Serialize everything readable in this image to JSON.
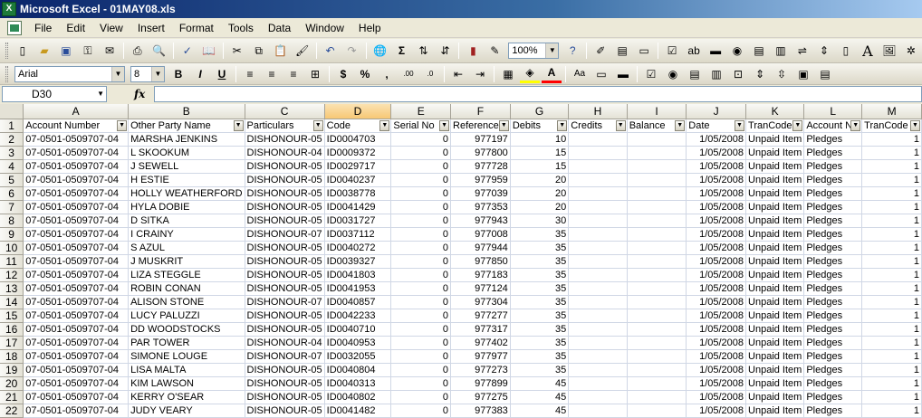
{
  "window": {
    "title": "Microsoft Excel - 01MAY08.xls",
    "app_icon": "excel-icon"
  },
  "menu": [
    "File",
    "Edit",
    "View",
    "Insert",
    "Format",
    "Tools",
    "Data",
    "Window",
    "Help"
  ],
  "toolbar": {
    "zoom": "100%",
    "font": "Arial",
    "font_size": "8",
    "autosum": "Σ"
  },
  "formula_bar": {
    "name_box": "D30",
    "fx": "fx",
    "content": ""
  },
  "grid": {
    "column_letters": [
      "A",
      "B",
      "C",
      "D",
      "E",
      "F",
      "G",
      "H",
      "I",
      "J",
      "K",
      "L",
      "M"
    ],
    "selected_column": "D",
    "header_row": [
      "Account Number",
      "Other Party Name",
      "Particulars",
      "Code",
      "Serial No",
      "Reference",
      "Debits",
      "Credits",
      "Balance",
      "Date",
      "TranCode",
      "Account N",
      "TranCode"
    ],
    "rows": [
      [
        "2",
        "07-0501-0509707-04",
        "MARSHA JENKINS",
        "DISHONOUR-05",
        "ID0004703",
        "0",
        "977197",
        "10",
        "",
        "",
        "1/05/2008",
        "Unpaid Item",
        "Pledges",
        "1"
      ],
      [
        "3",
        "07-0501-0509707-04",
        "L SKOOKUM",
        "DISHONOUR-04",
        "ID0009372",
        "0",
        "977800",
        "15",
        "",
        "",
        "1/05/2008",
        "Unpaid Item",
        "Pledges",
        "1"
      ],
      [
        "4",
        "07-0501-0509707-04",
        "J SEWELL",
        "DISHONOUR-05",
        "ID0029717",
        "0",
        "977728",
        "15",
        "",
        "",
        "1/05/2008",
        "Unpaid Item",
        "Pledges",
        "1"
      ],
      [
        "5",
        "07-0501-0509707-04",
        "H ESTIE",
        "DISHONOUR-05",
        "ID0040237",
        "0",
        "977959",
        "20",
        "",
        "",
        "1/05/2008",
        "Unpaid Item",
        "Pledges",
        "1"
      ],
      [
        "6",
        "07-0501-0509707-04",
        "HOLLY WEATHERFORD",
        "DISHONOUR-05",
        "ID0038778",
        "0",
        "977039",
        "20",
        "",
        "",
        "1/05/2008",
        "Unpaid Item",
        "Pledges",
        "1"
      ],
      [
        "7",
        "07-0501-0509707-04",
        "HYLA DOBIE",
        "DISHONOUR-05",
        "ID0041429",
        "0",
        "977353",
        "20",
        "",
        "",
        "1/05/2008",
        "Unpaid Item",
        "Pledges",
        "1"
      ],
      [
        "8",
        "07-0501-0509707-04",
        "D SITKA",
        "DISHONOUR-05",
        "ID0031727",
        "0",
        "977943",
        "30",
        "",
        "",
        "1/05/2008",
        "Unpaid Item",
        "Pledges",
        "1"
      ],
      [
        "9",
        "07-0501-0509707-04",
        "I CRAINY",
        "DISHONOUR-07",
        "ID0037112",
        "0",
        "977008",
        "35",
        "",
        "",
        "1/05/2008",
        "Unpaid Item",
        "Pledges",
        "1"
      ],
      [
        "10",
        "07-0501-0509707-04",
        "S AZUL",
        "DISHONOUR-05",
        "ID0040272",
        "0",
        "977944",
        "35",
        "",
        "",
        "1/05/2008",
        "Unpaid Item",
        "Pledges",
        "1"
      ],
      [
        "11",
        "07-0501-0509707-04",
        "J MUSKRIT",
        "DISHONOUR-05",
        "ID0039327",
        "0",
        "977850",
        "35",
        "",
        "",
        "1/05/2008",
        "Unpaid Item",
        "Pledges",
        "1"
      ],
      [
        "12",
        "07-0501-0509707-04",
        "LIZA STEGGLE",
        "DISHONOUR-05",
        "ID0041803",
        "0",
        "977183",
        "35",
        "",
        "",
        "1/05/2008",
        "Unpaid Item",
        "Pledges",
        "1"
      ],
      [
        "13",
        "07-0501-0509707-04",
        "ROBIN CONAN",
        "DISHONOUR-05",
        "ID0041953",
        "0",
        "977124",
        "35",
        "",
        "",
        "1/05/2008",
        "Unpaid Item",
        "Pledges",
        "1"
      ],
      [
        "14",
        "07-0501-0509707-04",
        "ALISON STONE",
        "DISHONOUR-07",
        "ID0040857",
        "0",
        "977304",
        "35",
        "",
        "",
        "1/05/2008",
        "Unpaid Item",
        "Pledges",
        "1"
      ],
      [
        "15",
        "07-0501-0509707-04",
        "LUCY PALUZZI",
        "DISHONOUR-05",
        "ID0042233",
        "0",
        "977277",
        "35",
        "",
        "",
        "1/05/2008",
        "Unpaid Item",
        "Pledges",
        "1"
      ],
      [
        "16",
        "07-0501-0509707-04",
        "DD WOODSTOCKS",
        "DISHONOUR-05",
        "ID0040710",
        "0",
        "977317",
        "35",
        "",
        "",
        "1/05/2008",
        "Unpaid Item",
        "Pledges",
        "1"
      ],
      [
        "17",
        "07-0501-0509707-04",
        "PAR TOWER",
        "DISHONOUR-04",
        "ID0040953",
        "0",
        "977402",
        "35",
        "",
        "",
        "1/05/2008",
        "Unpaid Item",
        "Pledges",
        "1"
      ],
      [
        "18",
        "07-0501-0509707-04",
        "SIMONE LOUGE",
        "DISHONOUR-07",
        "ID0032055",
        "0",
        "977977",
        "35",
        "",
        "",
        "1/05/2008",
        "Unpaid Item",
        "Pledges",
        "1"
      ],
      [
        "19",
        "07-0501-0509707-04",
        "LISA MALTA",
        "DISHONOUR-05",
        "ID0040804",
        "0",
        "977273",
        "35",
        "",
        "",
        "1/05/2008",
        "Unpaid Item",
        "Pledges",
        "1"
      ],
      [
        "20",
        "07-0501-0509707-04",
        "KIM LAWSON",
        "DISHONOUR-05",
        "ID0040313",
        "0",
        "977899",
        "45",
        "",
        "",
        "1/05/2008",
        "Unpaid Item",
        "Pledges",
        "1"
      ],
      [
        "21",
        "07-0501-0509707-04",
        "KERRY O'SEAR",
        "DISHONOUR-05",
        "ID0040802",
        "0",
        "977275",
        "45",
        "",
        "",
        "1/05/2008",
        "Unpaid Item",
        "Pledges",
        "1"
      ],
      [
        "22",
        "07-0501-0509707-04",
        "JUDY VEARY",
        "DISHONOUR-05",
        "ID0041482",
        "0",
        "977383",
        "45",
        "",
        "",
        "1/05/2008",
        "Unpaid Item",
        "Pledges",
        "1"
      ]
    ]
  }
}
